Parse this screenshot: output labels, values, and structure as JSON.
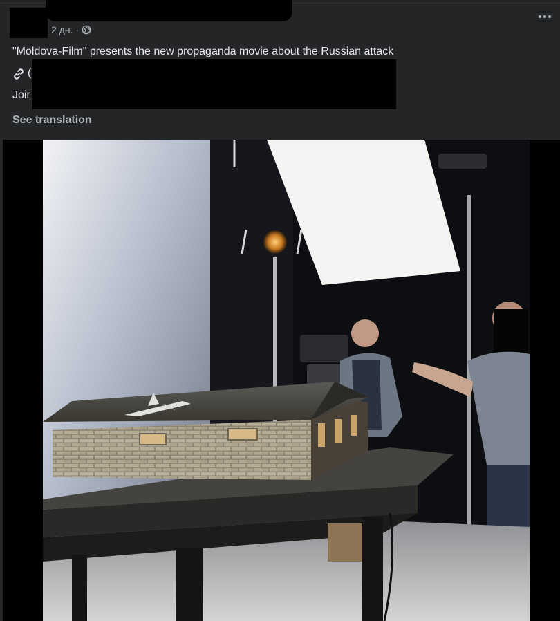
{
  "post": {
    "timestamp": "2 дн. ·",
    "caption": "\"Moldova-Film\" presents the new propaganda movie about the Russian attack",
    "link_text_partial": "(",
    "join_text_partial": "Joir",
    "see_translation": "See translation",
    "privacy_icon": "globe-icon",
    "link_icon": "link-icon",
    "more_icon": "more-options-icon"
  },
  "colors": {
    "background": "#242526",
    "text_primary": "#e4e6eb",
    "text_secondary": "#b0b3b8"
  }
}
